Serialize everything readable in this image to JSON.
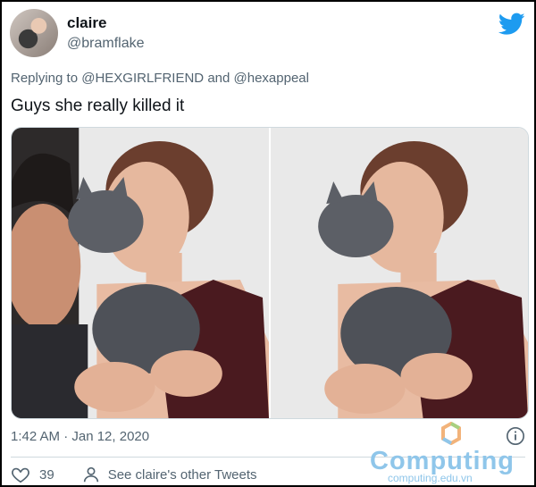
{
  "tweet": {
    "author_name": "claire",
    "author_handle": "@bramflake",
    "replying_prefix": "Replying to",
    "replying_user1": "@HEXGIRLFRIEND",
    "replying_and": "and",
    "replying_user2": "@hexappeal",
    "text": "Guys she really killed it",
    "timestamp": "1:42 AM · Jan 12, 2020",
    "like_count": "39",
    "see_others": "See claire's other Tweets"
  },
  "watermark": {
    "brand": "Computing",
    "url": "computing.edu.vn"
  },
  "colors": {
    "twitter_blue": "#1d9bf0",
    "text_primary": "#0f1419",
    "text_secondary": "#536471"
  },
  "icons": [
    "twitter-bird-icon",
    "info-icon",
    "heart-icon",
    "person-icon"
  ]
}
